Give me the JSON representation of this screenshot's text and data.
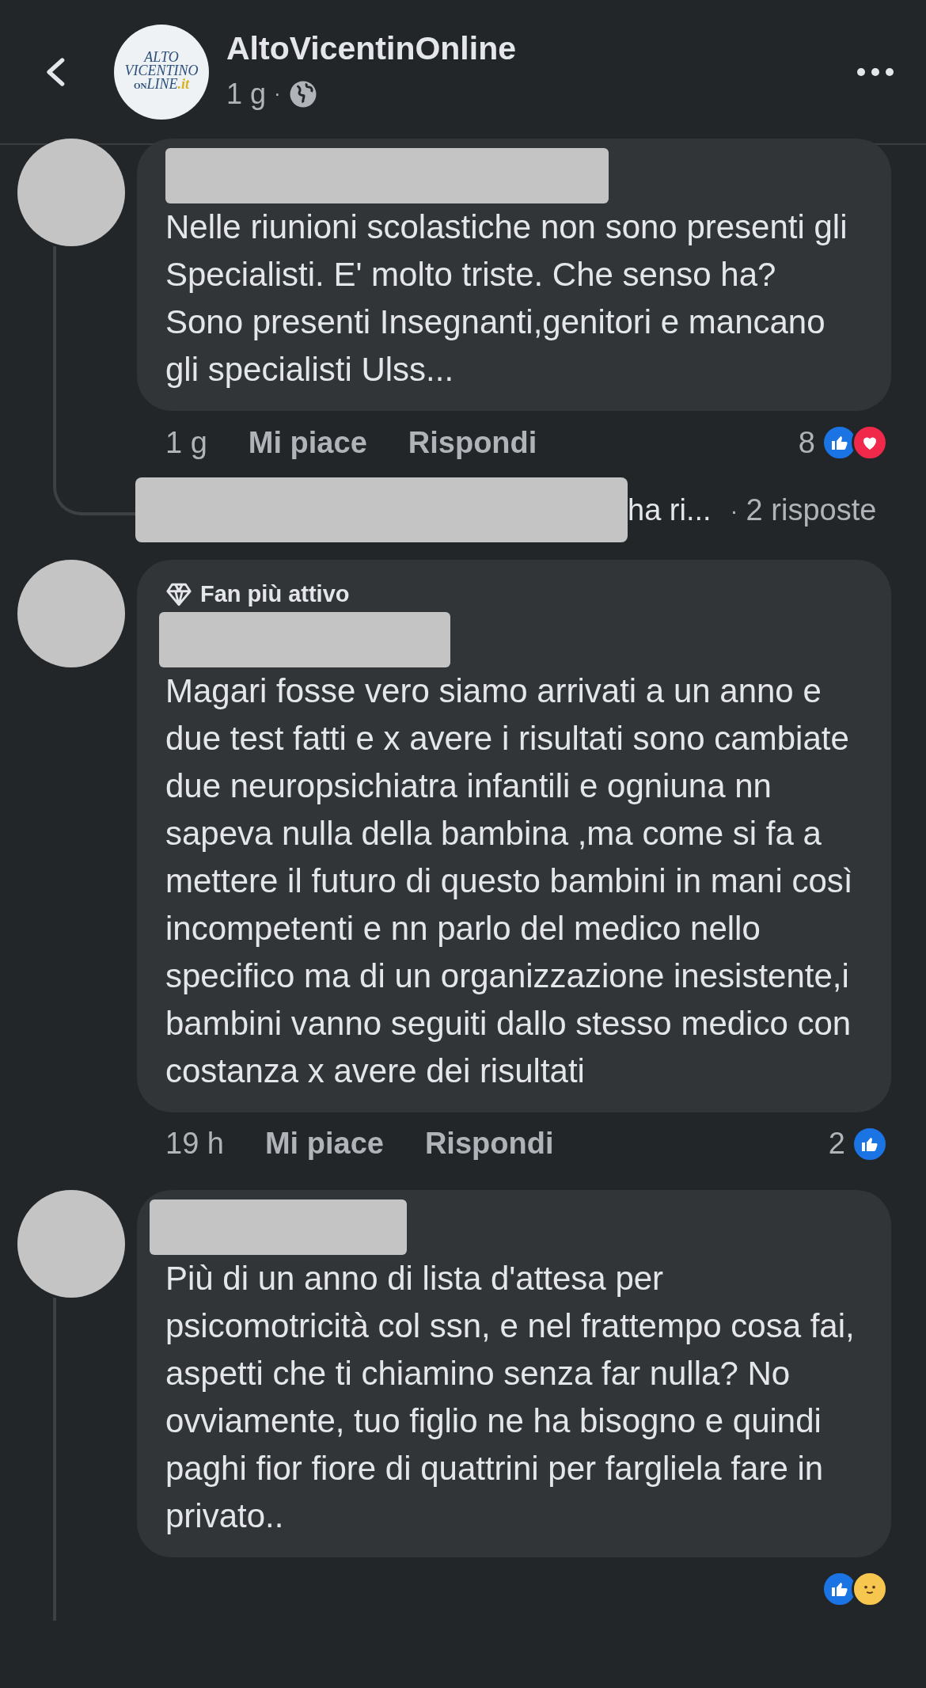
{
  "header": {
    "logo": {
      "line_1": "ALTO",
      "line_2": "VICENTINO",
      "line_3_a": "ON",
      "line_3_b": "LINE",
      "line_3_c": ".it"
    },
    "page_name": "AltoVicentinOnline",
    "time": "1 g",
    "separator": "·"
  },
  "comments": [
    {
      "text": "Nelle riunioni scolastiche non sono presenti gli Specialisti. E' molto triste. Che senso ha? Sono presenti Insegnanti,genitori e mancano gli specialisti Ulss...",
      "time": "1 g",
      "like": "Mi piace",
      "reply": "Rispondi",
      "count": "8",
      "reactions": [
        {
          "kind": "like"
        },
        {
          "kind": "love"
        }
      ],
      "replies_row": {
        "preview": "ha ri...",
        "separator": "·",
        "count": "2 risposte"
      }
    },
    {
      "badge": "Fan più attivo",
      "text": "Magari fosse vero siamo arrivati a un anno e due test fatti e x avere i risultati sono cambiate due neuropsichiatra infantili e ogniuna nn sapeva nulla della bambina ,ma come si fa a mettere il futuro di questo bambini in mani così incompetenti e nn parlo del medico nello specifico ma di un organizzazione inesistente,i bambini vanno seguiti dallo stesso medico con costanza x avere dei risultati",
      "time": "19 h",
      "like": "Mi piace",
      "reply": "Rispondi",
      "count": "2",
      "reactions": [
        {
          "kind": "like"
        }
      ]
    },
    {
      "text": "Più di un anno di lista d'attesa per psicomotricità col ssn, e nel frattempo cosa fai, aspetti che ti chiamino senza far nulla? No ovviamente, tuo figlio ne ha bisogno e quindi paghi fior fiore di quattrini per fargliela fare in privato..",
      "reactions": [
        {
          "kind": "like"
        },
        {
          "kind": "care"
        }
      ]
    }
  ]
}
